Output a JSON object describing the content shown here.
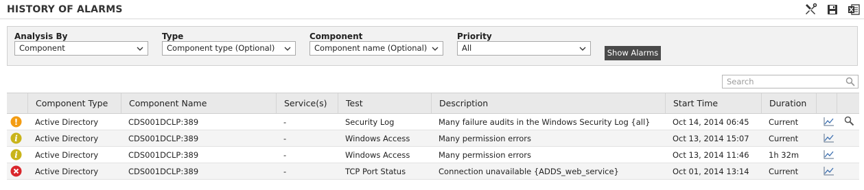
{
  "header": {
    "title": "HISTORY OF ALARMS",
    "icons": [
      "tools-icon",
      "save-icon",
      "excel-export-icon"
    ]
  },
  "filters": {
    "analysis_by": {
      "label": "Analysis By",
      "value": "Component"
    },
    "type": {
      "label": "Type",
      "value": "Component type (Optional)"
    },
    "component": {
      "label": "Component",
      "value": "Component name (Optional)"
    },
    "priority": {
      "label": "Priority",
      "value": "All"
    },
    "show_button": "Show Alarms"
  },
  "search": {
    "placeholder": "Search"
  },
  "table": {
    "columns": [
      "Component Type",
      "Component Name",
      "Service(s)",
      "Test",
      "Description",
      "Start Time",
      "Duration"
    ],
    "rows": [
      {
        "severity": "major",
        "severity_color": "#f39c12",
        "type": "Active Directory",
        "name": "CDS001DCLP:389",
        "services": "-",
        "test": "Security Log",
        "description": "Many failure audits in the Windows Security Log {all}",
        "start": "Oct 14, 2014 06:45",
        "duration": "Current",
        "has_zoom": true
      },
      {
        "severity": "minor",
        "severity_color": "#c9b41a",
        "type": "Active Directory",
        "name": "CDS001DCLP:389",
        "services": "-",
        "test": "Windows Access",
        "description": "Many permission errors",
        "start": "Oct 13, 2014 15:07",
        "duration": "Current",
        "has_zoom": false
      },
      {
        "severity": "minor",
        "severity_color": "#c9b41a",
        "type": "Active Directory",
        "name": "CDS001DCLP:389",
        "services": "-",
        "test": "Windows Access",
        "description": "Many permission errors",
        "start": "Oct 13, 2014 11:46",
        "duration": "1h 32m",
        "has_zoom": false
      },
      {
        "severity": "critical",
        "severity_color": "#d9262b",
        "type": "Active Directory",
        "name": "CDS001DCLP:389",
        "services": "-",
        "test": "TCP Port Status",
        "description": "Connection unavailable {ADDS_web_service}",
        "start": "Oct 01, 2014 13:14",
        "duration": "Current",
        "has_zoom": false
      }
    ]
  }
}
